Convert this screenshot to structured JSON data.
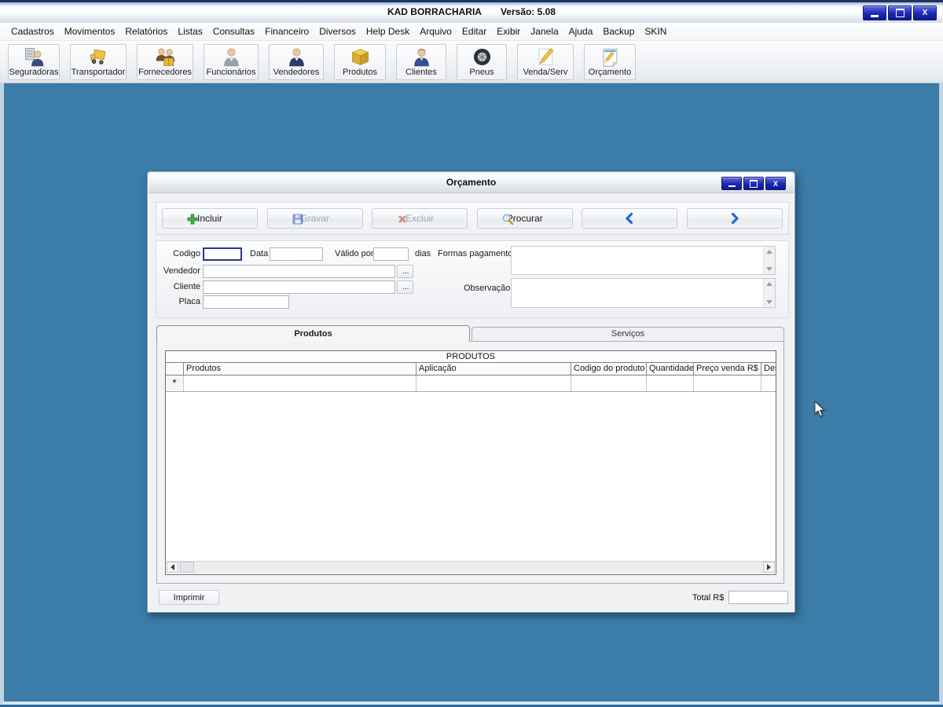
{
  "app": {
    "title": "KAD BORRACHARIA",
    "version": "Versão: 5.08",
    "window_controls": {
      "close": "X"
    },
    "menu": [
      "Cadastros",
      "Movimentos",
      "Relatórios",
      "Listas",
      "Consultas",
      "Financeiro",
      "Diversos",
      "Help Desk",
      "Arquivo",
      "Editar",
      "Exibir",
      "Janela",
      "Ajuda",
      "Backup",
      "SKIN"
    ],
    "toolbar": [
      {
        "label": "Seguradoras",
        "icon": "insurance-person-icon"
      },
      {
        "label": "Transportador",
        "icon": "truck-icon"
      },
      {
        "label": "Fornecedores",
        "icon": "suppliers-people-box-icon"
      },
      {
        "label": "Funcionários",
        "icon": "employee-person-icon"
      },
      {
        "label": "Vendedores",
        "icon": "salesman-person-icon"
      },
      {
        "label": "Produtos",
        "icon": "product-box-icon"
      },
      {
        "label": "Clientes",
        "icon": "client-person-icon"
      },
      {
        "label": "Pneus",
        "icon": "tire-icon"
      },
      {
        "label": "Venda/Serv",
        "icon": "pencil-icon"
      },
      {
        "label": "Orçamento",
        "icon": "note-pencil-icon"
      }
    ]
  },
  "dialog": {
    "title": "Orçamento",
    "window_controls": {
      "close": "X"
    },
    "toolbar": {
      "incluir": "Incluir",
      "gravar": "Gravar",
      "excluir": "Excluir",
      "procurar": "Procurar"
    },
    "form": {
      "codigo_label": "Codigo",
      "codigo_value": "",
      "data_label": "Data",
      "data_value": "",
      "valido_por_label": "Válido por",
      "valido_por_value": "",
      "dias_label": "dias",
      "formas_pagamento_label": "Formas pagamento",
      "formas_pagamento_value": "",
      "vendedor_label": "Vendedor",
      "vendedor_value": "",
      "cliente_label": "Cliente",
      "cliente_value": "",
      "observacao_label": "Observação",
      "observacao_value": "",
      "placa_label": "Placa",
      "placa_value": "",
      "browse_label": "..."
    },
    "tabs": [
      {
        "label": "Produtos",
        "active": true
      },
      {
        "label": "Serviços",
        "active": false
      }
    ],
    "grid": {
      "band_title": "PRODUTOS",
      "columns": [
        "Produtos",
        "Aplicação",
        "Codigo do produto",
        "Quantidade",
        "Preço venda R$",
        "Des"
      ],
      "new_row_marker": "*"
    },
    "footer": {
      "imprimir": "Imprimir",
      "total_label": "Total R$",
      "total_value": ""
    }
  },
  "colors": {
    "desktop": "#3C7CA8",
    "window_button_blue": "#1C27B4",
    "accent_blue": "#1B6FD4",
    "incluir_green": "#44B044",
    "excluir_red": "#D0382C",
    "save_blue": "#2B5BCB"
  }
}
